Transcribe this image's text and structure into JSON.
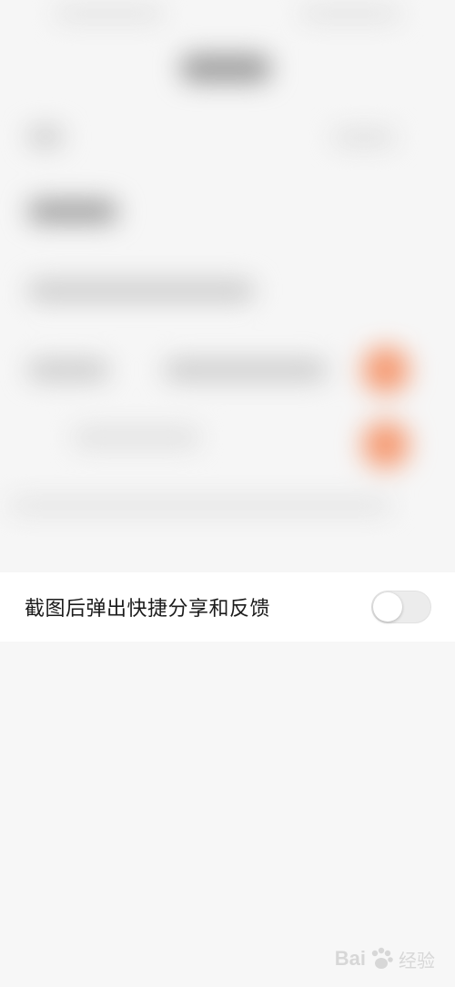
{
  "setting": {
    "label": "截图后弹出快捷分享和反馈",
    "toggle_on": false
  },
  "watermark": {
    "brand_left": "Bai",
    "brand_right": "经验",
    "icon": "paw-icon"
  },
  "colors": {
    "background": "#f7f7f7",
    "row_background": "#ffffff",
    "label_text": "#1b1b1b",
    "toggle_track_off": "#ececec",
    "toggle_knob": "#ffffff",
    "accent_orange_blurred": "#f59a72"
  }
}
